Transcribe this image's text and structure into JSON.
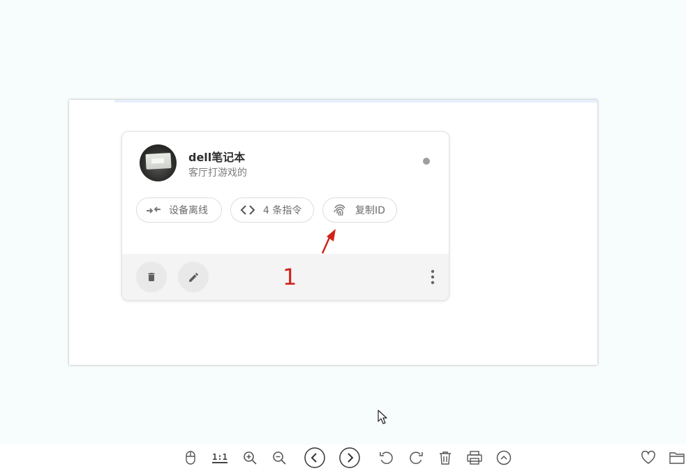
{
  "card": {
    "device_name": "dell笔记本",
    "device_description": "客厅打游戏的",
    "status_color": "#9e9e9e",
    "chips": {
      "offline_label": "设备离线",
      "commands_label": "4 条指令",
      "copy_id_label": "复制ID"
    }
  },
  "annotation": {
    "number": "1",
    "color": "#d0231b"
  },
  "toolbar": {
    "actual_size_label": "1:1",
    "icons": [
      "mouse-icon",
      "actual-size-icon",
      "zoom-in-icon",
      "zoom-out-icon",
      "previous-icon",
      "next-icon",
      "rotate-left-icon",
      "rotate-right-icon",
      "delete-icon",
      "print-icon",
      "collapse-icon",
      "favorite-icon",
      "open-folder-icon"
    ]
  }
}
